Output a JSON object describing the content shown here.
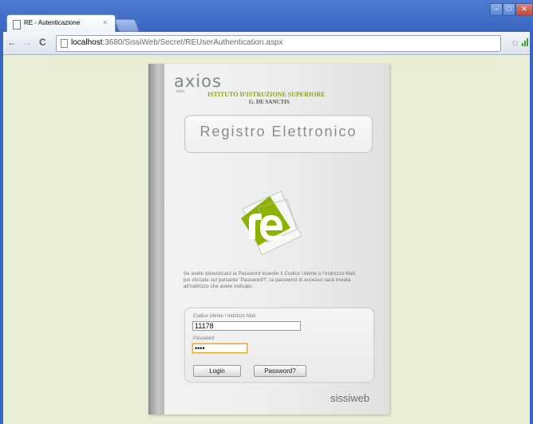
{
  "browser": {
    "tab_title": "RE - Autenticazione",
    "tab_close": "×",
    "url_host": "localhost",
    "url_rest": ":3680/SissiWeb/Secret/REUserAuthentication.aspx",
    "back": "←",
    "forward": "→",
    "reload": "C",
    "bookmark_star": "☆",
    "window_controls": [
      "–",
      "□",
      "✕"
    ]
  },
  "login": {
    "brand_logo": "axios",
    "brand_sub": "italia",
    "school_line1": "ISTITUTO D'ISTRUZIONE SUPERIORE",
    "school_line2": "G. DE SANCTIS",
    "app_title": "Registro Elettronico",
    "info_text": "Se avete dimenticato la Password inserite il Codice Utente o l'Indirizzo Mail, poi cliccate sul pulsante 'Password?', la password di accesso sarà inviata all'indirizzo che avete indicato.",
    "user_label": "Codice Utente / Indirizzo Mail",
    "user_value": "11178",
    "password_label": "Password",
    "password_value": "••••",
    "login_button": "Login",
    "password_button": "Password?",
    "footer_brand": "sissiweb"
  },
  "colors": {
    "page_background": "#e9efd4",
    "school_green": "#8aa01a",
    "logo_green": "#8cb300"
  }
}
